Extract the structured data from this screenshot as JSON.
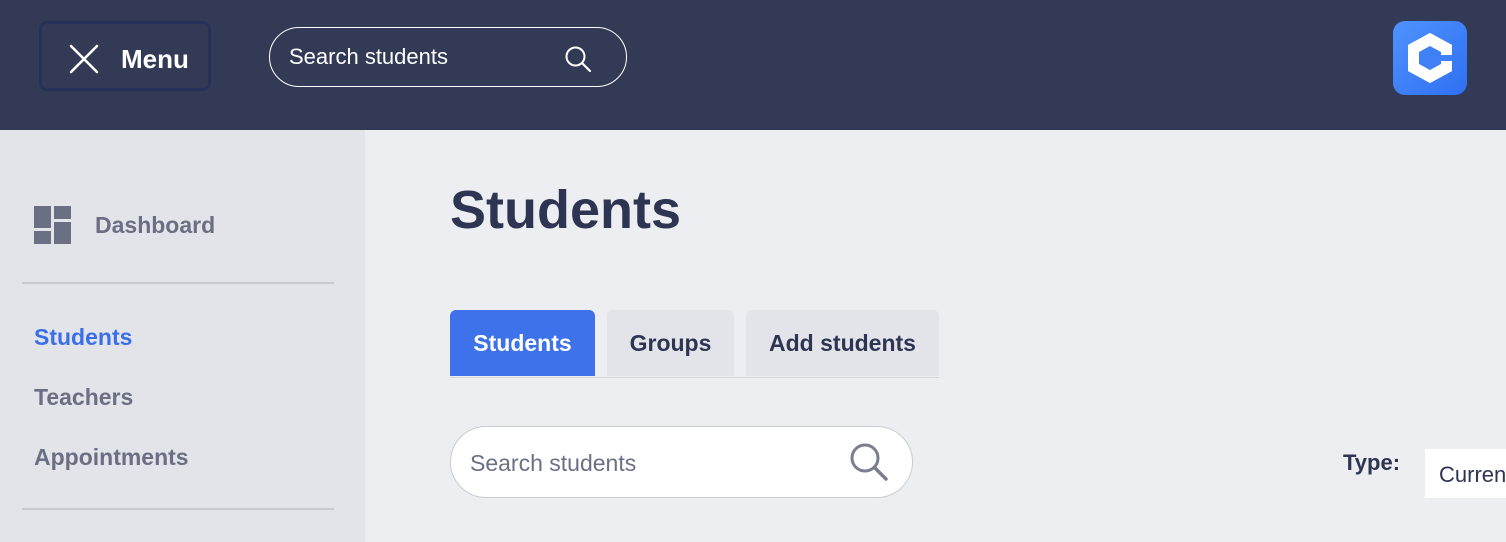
{
  "topbar": {
    "menu_label": "Menu",
    "search_placeholder": "Search students",
    "menu_icon": "close-icon",
    "search_icon": "search-icon",
    "logo_icon": "app-logo",
    "background": "#323a56",
    "logo_color": "#3d7cf5"
  },
  "sidebar": {
    "dashboard_label": "Dashboard",
    "dashboard_icon": "dashboard-icon",
    "items": [
      {
        "label": "Students",
        "active": true
      },
      {
        "label": "Teachers",
        "active": false
      },
      {
        "label": "Appointments",
        "active": false
      }
    ],
    "active_color": "#3a6fe8"
  },
  "main": {
    "title": "Students",
    "tabs": [
      {
        "label": "Students",
        "active": true
      },
      {
        "label": "Groups",
        "active": false
      },
      {
        "label": "Add students",
        "active": false
      }
    ],
    "search_placeholder": "Search students",
    "type_label": "Type:",
    "type_value": "Current"
  }
}
